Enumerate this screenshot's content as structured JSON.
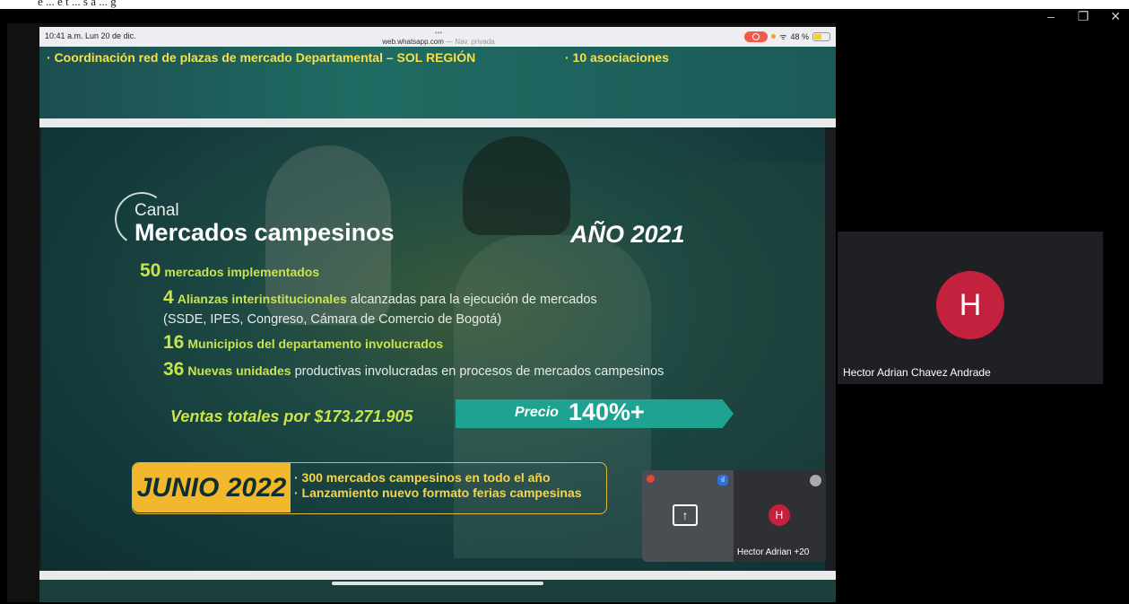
{
  "top_text": "e ... e t ... s a ... g",
  "window_controls": {
    "minimize": "–",
    "restore": "❐",
    "close": "✕"
  },
  "ipad_status": {
    "time": "10:41 a.m.  Lun 20 de dic.",
    "dots": "•••",
    "url_host": "web.whatsapp.com",
    "url_suffix": " — Nav. privada",
    "battery": "48 %"
  },
  "slide_top": {
    "line1": "· Coordinación red de plazas de mercado Departamental – SOL REGIÓN",
    "line2": "· 10 asociaciones"
  },
  "slide": {
    "canal": "Canal",
    "title": "Mercados campesinos",
    "year": "AÑO 2021",
    "rows": [
      {
        "num": "50",
        "hl": "mercados implementados",
        "rest": ""
      },
      {
        "num": "4",
        "hl": "Alianzas interinstitucionales",
        "rest": " alcanzadas para la ejecución de mercados"
      },
      {
        "num": "",
        "hl": "",
        "rest": "(SSDE, IPES, Congreso, Cámara de Comercio de Bogotá)"
      },
      {
        "num": "16",
        "hl": "Municipios del departamento involucrados",
        "rest": ""
      },
      {
        "num": "36",
        "hl": "Nuevas unidades",
        "rest": " productivas involucradas en procesos de mercados campesinos"
      }
    ],
    "sales": "Ventas totales por $173.271.905",
    "price_label": "Precio",
    "price_value": "140%+",
    "junio": {
      "label": "JUNIO 2022",
      "items": [
        "· 300 mercados campesinos en todo el año",
        "· Lanzamiento nuevo formato ferias campesinas"
      ]
    }
  },
  "mini_meet": {
    "share_icon": "↑",
    "avatar_letter": "H",
    "name": "Hector Adrian",
    "extra": "+20"
  },
  "participant": {
    "avatar_letter": "H",
    "name": "Hector Adrian Chavez Andrade"
  }
}
